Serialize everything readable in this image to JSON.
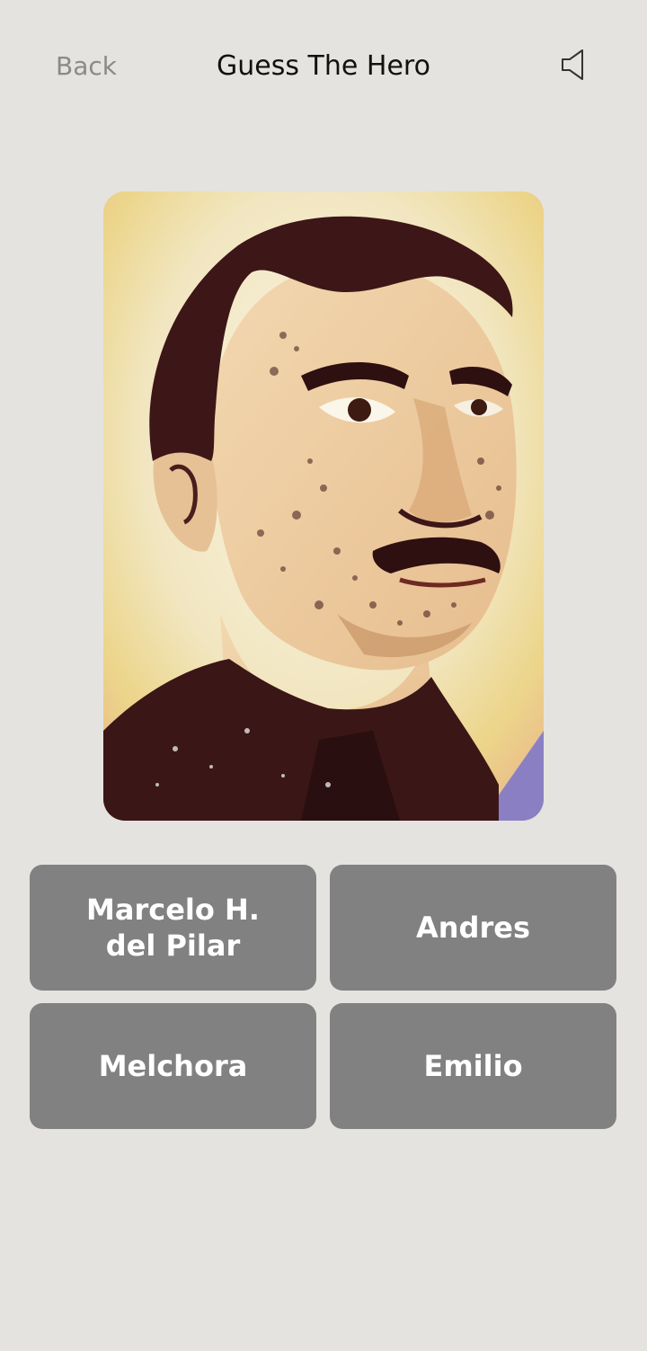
{
  "header": {
    "back_label": "Back",
    "title": "Guess The Hero",
    "sound_icon": "speaker-icon"
  },
  "portrait": {
    "icon": "hero-portrait-illustration"
  },
  "answers": [
    {
      "label": "Marcelo H. del Pilar"
    },
    {
      "label": "Andres"
    },
    {
      "label": "Melchora"
    },
    {
      "label": "Emilio"
    }
  ],
  "colors": {
    "background": "#e4e3df",
    "option_button": "#818181",
    "option_text": "#ffffff",
    "back_text": "#8a8a8a"
  }
}
